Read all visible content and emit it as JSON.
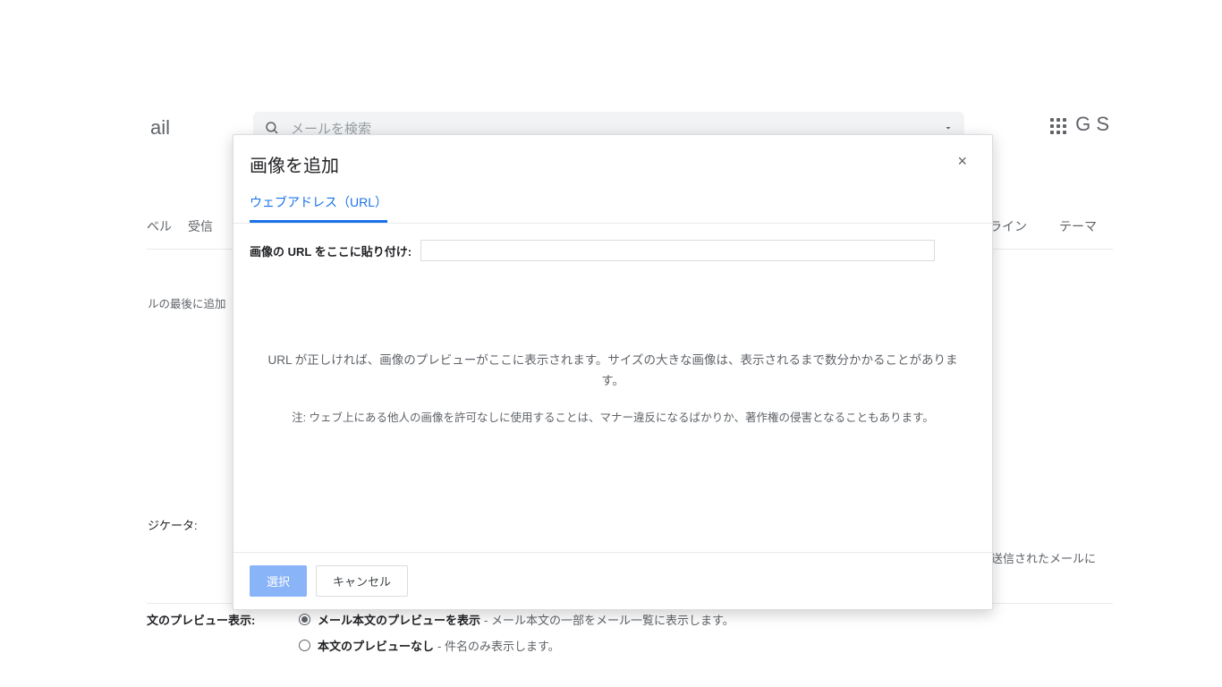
{
  "background": {
    "logo_fragment": "ail",
    "search_placeholder": "メールを検索",
    "g_fragment": "G S",
    "tabs_left": [
      "ベル",
      "受信"
    ],
    "tabs_right": [
      "フライン",
      "テーマ"
    ],
    "text_fragment_1": "ルの最後に追加",
    "text_fragment_2": "ジケータ:",
    "text_fragment_3": "送信されたメールに",
    "preview": {
      "section_label": "文のプレビュー表示:",
      "opt1_bold": "メール本文のプレビューを表示",
      "opt1_desc": "- メール本文の一部をメール一覧に表示します。",
      "opt2_bold": "本文のプレビューなし",
      "opt2_desc": "- 件名のみ表示します。"
    }
  },
  "modal": {
    "title": "画像を追加",
    "close": "×",
    "tab_label": "ウェブアドレス（URL）",
    "url_label": "画像の URL をここに貼り付け:",
    "url_value": "",
    "preview_hint": "URL が正しければ、画像のプレビューがここに表示されます。サイズの大きな画像は、表示されるまで数分かかることがあります。",
    "note_prefix": "注: ",
    "note_body": "ウェブ上にある他人の画像を許可なしに使用することは、マナー違反になるばかりか、著作権の侵害となることもあります。",
    "btn_select": "選択",
    "btn_cancel": "キャンセル"
  }
}
